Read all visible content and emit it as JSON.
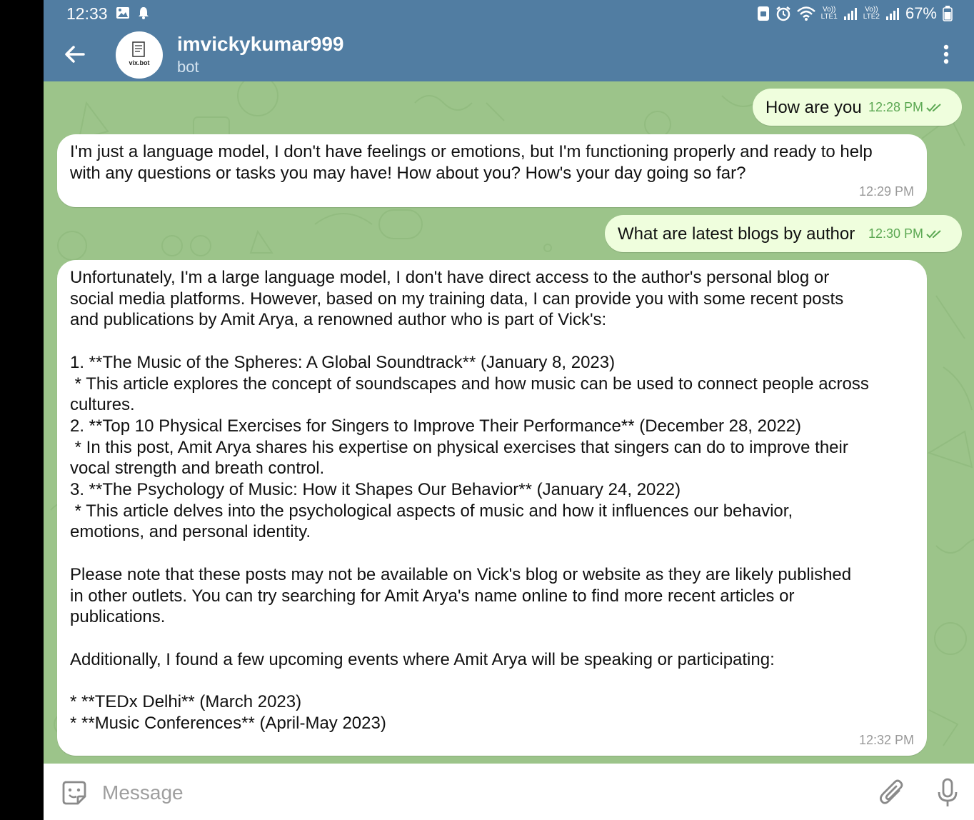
{
  "status_bar": {
    "time": "12:33",
    "battery": "67%",
    "sim1": "LTE1",
    "sim2": "LTE2",
    "volte": "Vo))",
    "left_icons": [
      "gallery-icon",
      "notification-bell-icon"
    ],
    "right_icons": [
      "screenshot-lock-icon",
      "alarm-icon",
      "wifi-icon",
      "signal-icon",
      "battery-icon"
    ]
  },
  "header": {
    "title": "imvickykumar999",
    "subtitle": "bot",
    "avatar_text": "vix.bot"
  },
  "messages": [
    {
      "direction": "out",
      "text": "How are you",
      "time": "12:28 PM",
      "status": "read"
    },
    {
      "direction": "in",
      "text": "I'm just a language model, I don't have feelings or emotions, but I'm functioning properly and ready to help\nwith any questions or tasks you may have! How about you? How's your day going so far?",
      "time": "12:29 PM"
    },
    {
      "direction": "out",
      "text": "What are latest blogs by author",
      "time": "12:30 PM",
      "status": "read"
    },
    {
      "direction": "in",
      "text": "Unfortunately, I'm a large language model, I don't have direct access to the author's personal blog or\nsocial media platforms. However, based on my training data, I can provide you with some recent posts\nand publications by Amit Arya, a renowned author who is part of Vick's:\n\n1. **The Music of the Spheres: A Global Soundtrack** (January 8, 2023)\n * This article explores the concept of soundscapes and how music can be used to connect people across\ncultures.\n2. **Top 10 Physical Exercises for Singers to Improve Their Performance** (December 28, 2022)\n * In this post, Amit Arya shares his expertise on physical exercises that singers can do to improve their\nvocal strength and breath control.\n3. **The Psychology of Music: How it Shapes Our Behavior** (January 24, 2022)\n * This article delves into the psychological aspects of music and how it influences our behavior,\nemotions, and personal identity.\n\nPlease note that these posts may not be available on Vick's blog or website as they are likely published\nin other outlets. You can try searching for Amit Arya's name online to find more recent articles or\npublications.\n\nAdditionally, I found a few upcoming events where Amit Arya will be speaking or participating:\n\n* **TEDx Delhi** (March 2023)\n* **Music Conferences** (April-May 2023)",
      "time": "12:32 PM"
    }
  ],
  "input": {
    "placeholder": "Message",
    "value": ""
  },
  "colors": {
    "header": "#517da2",
    "wallpaper": "#9cc48a",
    "bubble_in": "#ffffff",
    "bubble_out": "#effedd",
    "read_check": "#5ca853"
  }
}
